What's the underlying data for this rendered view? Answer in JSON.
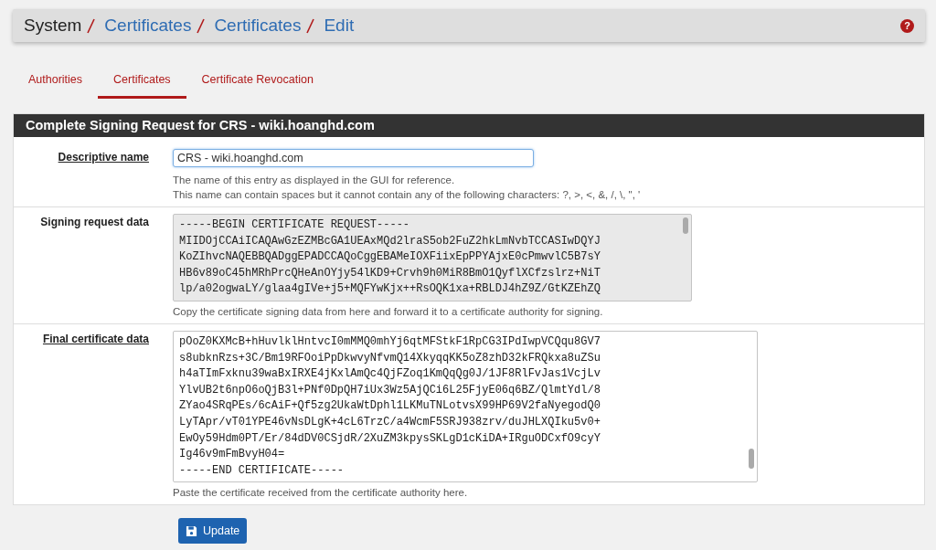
{
  "breadcrumb": [
    {
      "text": "System",
      "link": false
    },
    {
      "text": "Certificates",
      "link": true
    },
    {
      "text": "Certificates",
      "link": true
    },
    {
      "text": "Edit",
      "link": true
    }
  ],
  "help_icon": "?",
  "tabs": [
    {
      "label": "Authorities",
      "selected": false
    },
    {
      "label": "Certificates",
      "selected": true
    },
    {
      "label": "Certificate Revocation",
      "selected": false
    }
  ],
  "panel": {
    "title": "Complete Signing Request for CRS - wiki.hoanghd.com",
    "fields": [
      {
        "kind": "text",
        "label": "Descriptive name",
        "required": true,
        "readonly": false,
        "value": "CRS - wiki.hoanghd.com",
        "help": [
          "The name of this entry as displayed in the GUI for reference.",
          "This name can contain spaces but it cannot contain any of the following characters: ?, >, <, &, /, \\, \", '"
        ]
      },
      {
        "kind": "textarea",
        "label": "Signing request data",
        "required": false,
        "readonly": true,
        "lines": [
          "-----BEGIN CERTIFICATE REQUEST-----",
          "MIIDOjCCAiICAQAwGzEZMBcGA1UEAxMQd2lraS5ob2FuZ2hkLmNvbTCCASIwDQYJ",
          "KoZIhvcNAQEBBQADggEPADCCAQoCggEBAMeIOXFiixEpPPYAjxE0cPmwvlC5B7sY",
          "HB6v89oC45hMRhPrcQHeAnOYjy54lKD9+Crvh9h0MiR8BmO1QyflXCfzslrz+NiT",
          "lp/a02ogwaLY/glaa4gIVe+j5+MQFYwKjx++RsOQK1xa+RBLDJ4hZ9Z/GtKZEhZQ"
        ],
        "help": [
          "Copy the certificate signing data from here and forward it to a certificate authority for signing."
        ]
      },
      {
        "kind": "textarea",
        "label": "Final certificate data",
        "required": true,
        "readonly": false,
        "lines": [
          "pOoZ0KXMcB+hHuvlklHntvcI0mMMQ0mhYj6qtMFStkF1RpCG3IPdIwpVCQqu8GV7",
          "s8ubknRzs+3C/Bm19RFOoiPpDkwvyNfvmQ14XkyqqKK5oZ8zhD32kFRQkxa8uZSu",
          "h4aTImFxknu39waBxIRXE4jKxlAmQc4QjFZoq1KmQqQg0J/1JF8RlFvJas1VcjLv",
          "YlvUB2t6npO6oQjB3l+PNf0DpQH7iUx3Wz5AjQCi6L25FjyE06q6BZ/QlmtYdl/8",
          "ZYao4SRqPEs/6cAiF+Qf5zg2UkaWtDphl1LKMuTNLotvsX99HP69V2faNyegodQ0",
          "LyTApr/vT01YPE46vNsDLgK+4cL6TrzC/a4WcmF5SRJ938zrv/duJHLXQIku5v0+",
          "EwOy59Hdm0PT/Er/84dDV0CSjdR/2XuZM3kpysSKLgD1cKiDA+IRguODCxfO9cyY",
          "Ig46v9mFmBvyH04=",
          "-----END CERTIFICATE-----"
        ],
        "help": [
          "Paste the certificate received from the certificate authority here."
        ]
      }
    ]
  },
  "update_button": "Update"
}
